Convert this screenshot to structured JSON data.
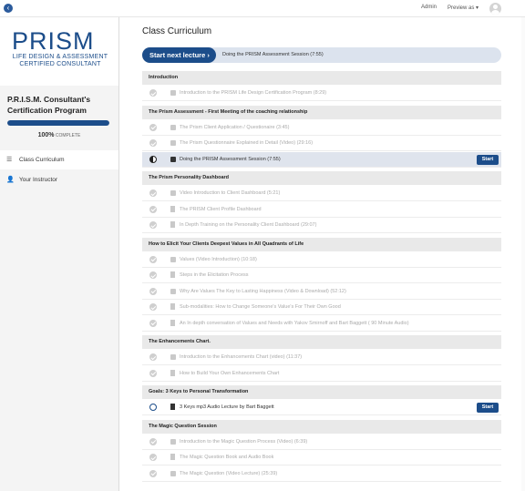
{
  "topbar": {
    "back_icon": "chevron-left-icon",
    "admin": "Admin",
    "preview": "Preview as ▾"
  },
  "sidebar": {
    "logo": {
      "brand": "PRISM",
      "line1": "LIFE DESIGN & ASSESSMENT",
      "line2": "CERTIFIED CONSULTANT"
    },
    "course_title": "P.R.I.S.M. Consultant's Certification Program",
    "progress": {
      "percent": 100,
      "percent_label": "100%",
      "suffix": "COMPLETE"
    },
    "nav": [
      {
        "label": "Class Curriculum",
        "icon": "curriculum-icon",
        "active": true
      },
      {
        "label": "Your Instructor",
        "icon": "user-icon",
        "active": false
      }
    ]
  },
  "main": {
    "title": "Class Curriculum",
    "next": {
      "button": "Start next lecture ›",
      "lecture": "Doing the PRISM Assessment Session (7:55)"
    },
    "start_label": "Start",
    "sections": [
      {
        "title": "Introduction",
        "lectures": [
          {
            "title": "Introduction to the PRISM Life Design Certification Program (8:29)",
            "type": "video",
            "status": "done"
          }
        ]
      },
      {
        "title": "The Prism Assessment - First Meeting of the coaching relationship",
        "lectures": [
          {
            "title": "The Prism Client Application / Questionaire (3:45)",
            "type": "video",
            "status": "done"
          },
          {
            "title": "The Prism Questionnaire Explained in Detail  (Video) (29:16)",
            "type": "video",
            "status": "done"
          },
          {
            "title": "Doing the PRISM Assessment Session (7:55)",
            "type": "video",
            "status": "half"
          }
        ]
      },
      {
        "title": "The Prism Personality Dashboard",
        "lectures": [
          {
            "title": "Video Introduction to Client Dashboard (5:21)",
            "type": "video",
            "status": "done"
          },
          {
            "title": "The PRISM Client Profile Dashboard",
            "type": "doc",
            "status": "done"
          },
          {
            "title": "In Depth Training on the Personality Client Dashboard (29:07)",
            "type": "doc",
            "status": "done"
          }
        ]
      },
      {
        "title": "How to Elicit Your Clients Deepest Values in All Quadrants of Life",
        "lectures": [
          {
            "title": "Values (Video Introduction) (10:18)",
            "type": "video",
            "status": "done"
          },
          {
            "title": "Steps in the Elicitation Process",
            "type": "doc",
            "status": "done"
          },
          {
            "title": "Why Are Values The Key to Lasting Happiness (Video & Download) (52:12)",
            "type": "video",
            "status": "done"
          },
          {
            "title": "Sub-modalities: How to Change Someone's Value's For Their Own Good",
            "type": "doc",
            "status": "done"
          },
          {
            "title": "An In depth conversation of Values and Needs with Yakov Smirnoff and Bart Baggett ( 90 Minute Audio)",
            "type": "doc",
            "status": "done"
          }
        ]
      },
      {
        "title": "The Enhancements Chart.",
        "lectures": [
          {
            "title": "Introduction to the Enhancements Chart (video) (11:37)",
            "type": "video",
            "status": "done"
          },
          {
            "title": "How to Build Your Own Enhancements Chart",
            "type": "doc",
            "status": "done"
          }
        ]
      },
      {
        "title": "Goals: 3 Keys to Personal Transformation",
        "lectures": [
          {
            "title": "3 Keys mp3 Audio Lecture by Bart Baggett",
            "type": "doc",
            "status": "empty"
          }
        ]
      },
      {
        "title": "The Magic Question Session",
        "lectures": [
          {
            "title": "Introduction to the Magic Question Process (Video) (6:39)",
            "type": "video",
            "status": "done"
          },
          {
            "title": "The Magic Question Book and Audio Book",
            "type": "doc",
            "status": "done"
          },
          {
            "title": "The Magic Question (Video Lecture) (25:39)",
            "type": "video",
            "status": "done"
          }
        ]
      }
    ]
  }
}
